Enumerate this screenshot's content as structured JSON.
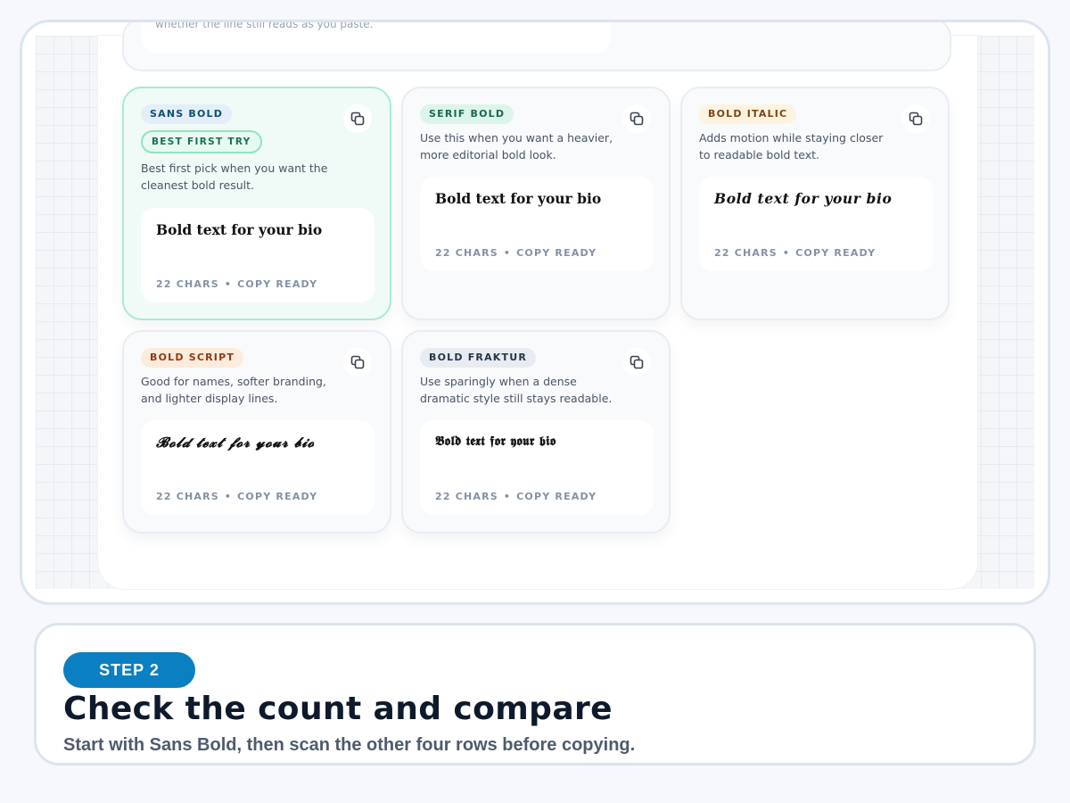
{
  "top_card": {
    "text": "whether the line still reads as you paste."
  },
  "cards": [
    {
      "badge": "SANS BOLD",
      "best_badge": "BEST FIRST TRY",
      "description": "Best first pick when you want the cleanest bold result.",
      "preview": "Bold text for your bio",
      "chars": "22 CHARS",
      "status": "COPY READY"
    },
    {
      "badge": "SERIF BOLD",
      "description": "Use this when you want a heavier, more editorial bold look.",
      "preview": "Bold text for your bio",
      "chars": "22 CHARS",
      "status": "COPY READY"
    },
    {
      "badge": "BOLD ITALIC",
      "description": "Adds motion while staying closer to readable bold text.",
      "preview": "Bold text for your bio",
      "chars": "22 CHARS",
      "status": "COPY READY"
    },
    {
      "badge": "BOLD SCRIPT",
      "description": "Good for names, softer branding, and lighter display lines.",
      "preview": "𝓑𝓸𝓵𝓭 𝓽𝓮𝔁𝓽 𝓯𝓸𝓻 𝔂𝓸𝓾𝓻 𝓫𝓲𝓸",
      "chars": "22 CHARS",
      "status": "COPY READY"
    },
    {
      "badge": "BOLD FRAKTUR",
      "description": "Use sparingly when a dense dramatic style still stays readable.",
      "preview": "𝕭𝖔𝖑𝖉 𝖙𝖊𝖝𝖙 𝖋𝖔𝖗 𝖞𝖔𝖚𝖗 𝖇𝖎𝖔",
      "chars": "22 CHARS",
      "status": "COPY READY"
    }
  ],
  "step": {
    "label": "STEP 2",
    "title": "Check the count and compare",
    "subtitle": "Start with Sans Bold, then scan the other four rows before copying."
  },
  "icons": {
    "copy": "copy-icon"
  },
  "colors": {
    "accent": "#0a7fc2",
    "featured_border": "#a7ecd0"
  }
}
